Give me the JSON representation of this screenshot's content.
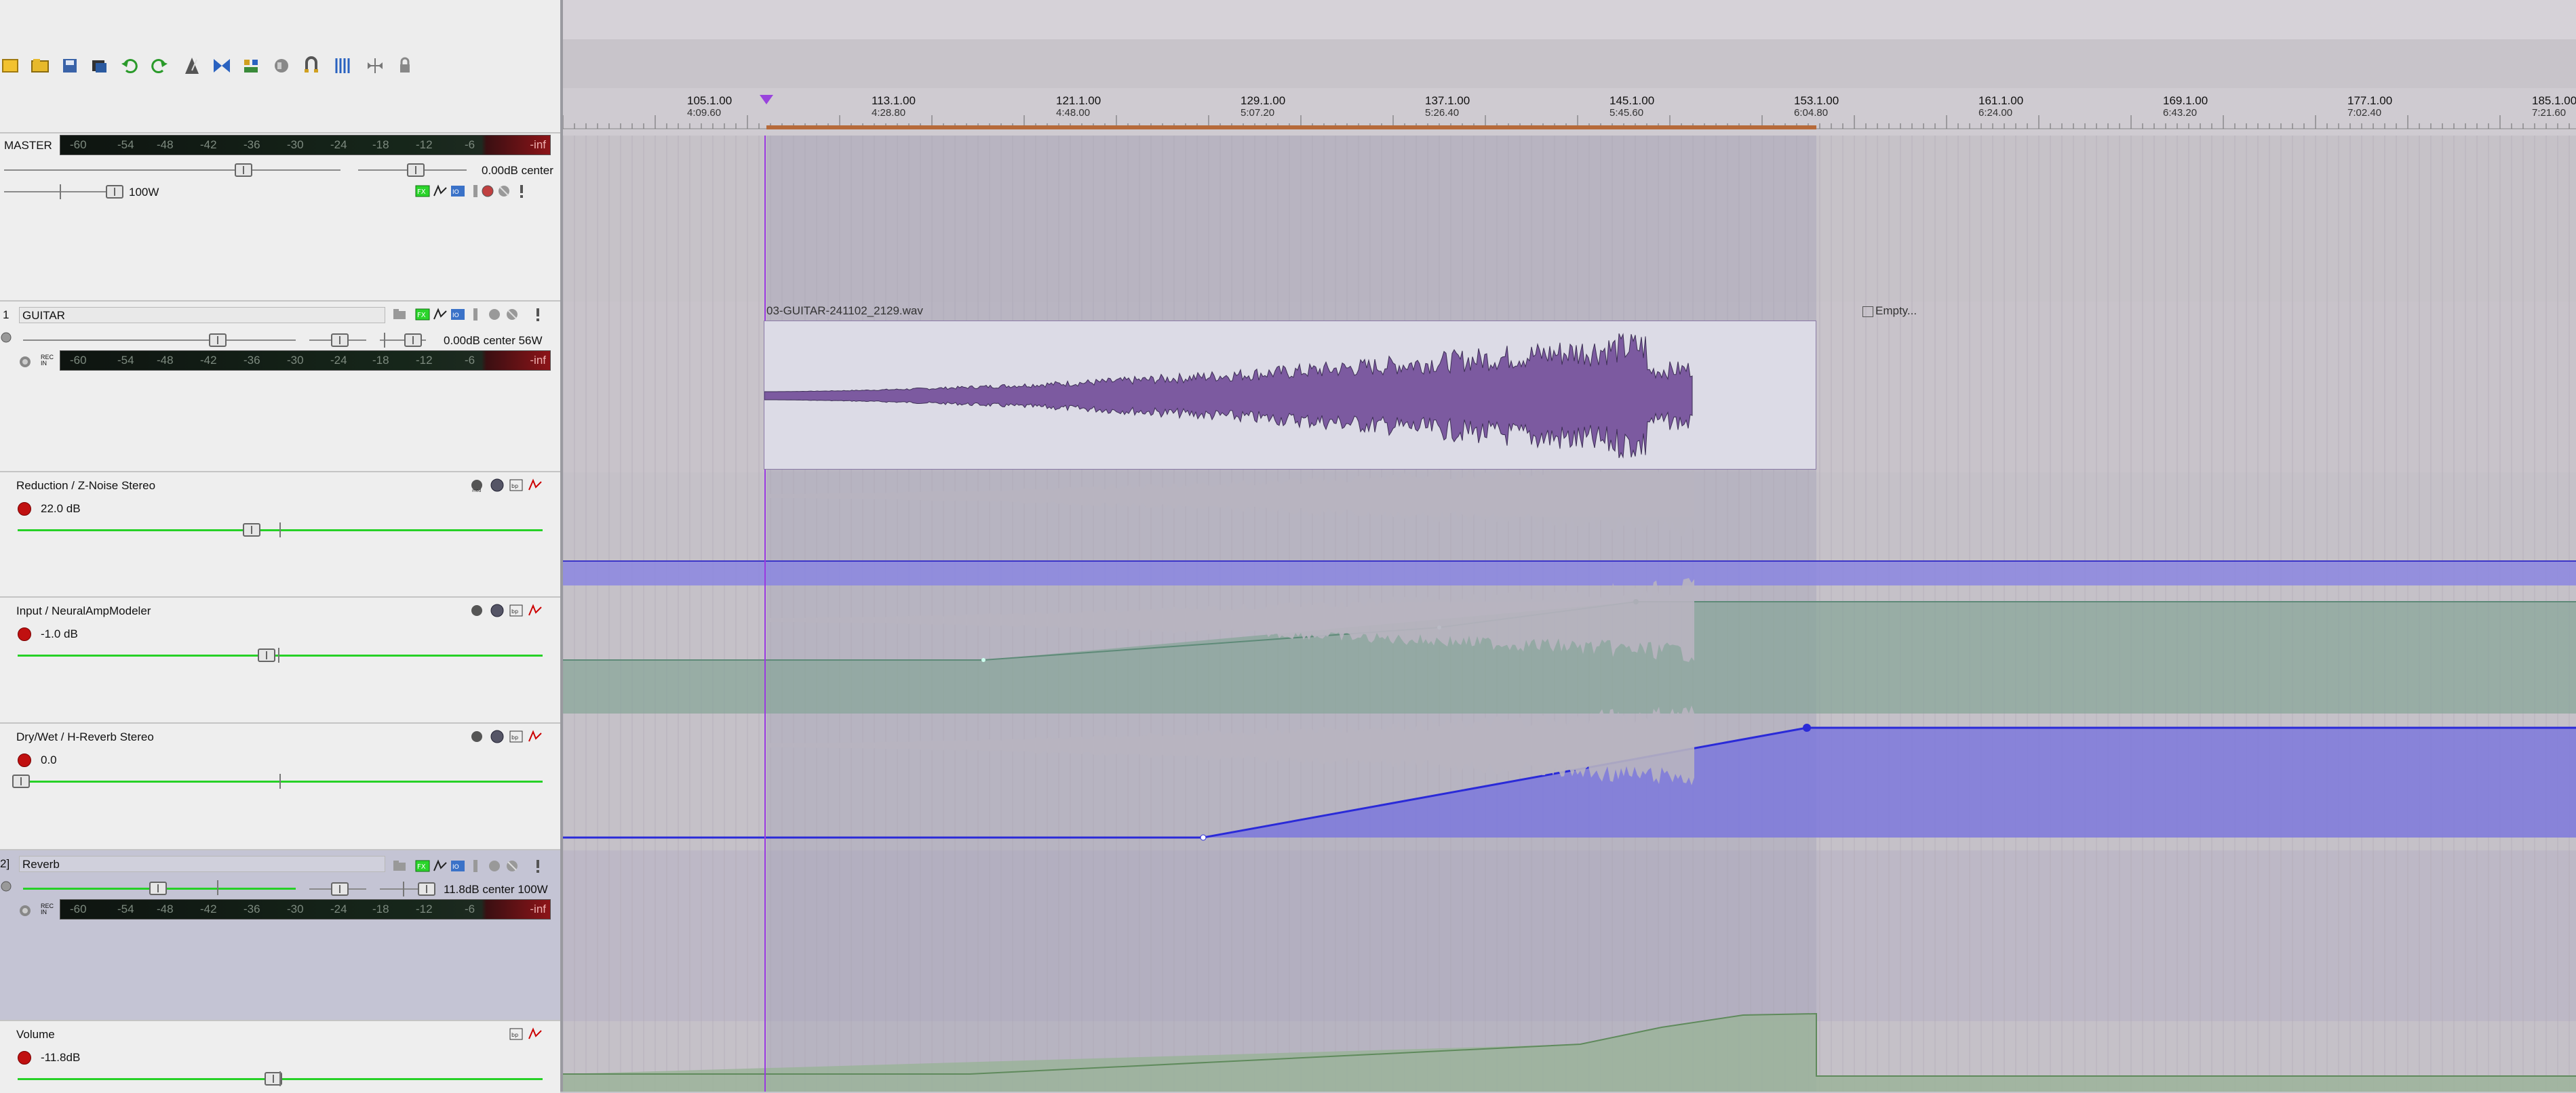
{
  "toolbar": {
    "icons": [
      "new-project-icon",
      "open-icon",
      "save-icon",
      "project-settings-icon",
      "undo-icon",
      "redo-icon",
      "metronome-icon",
      "loop-icon",
      "ripple-icon",
      "envelope-lock-icon",
      "snap-icon",
      "grid-icon",
      "crossfade-icon",
      "lock-icon"
    ]
  },
  "master": {
    "name": "MASTER",
    "vol_readout": "0.00dB center",
    "width_readout": "100W",
    "meter_inf": "-inf"
  },
  "meter_ticks": [
    "-60",
    "-54",
    "-48",
    "-42",
    "-36",
    "-30",
    "-24",
    "-18",
    "-12",
    "-6"
  ],
  "tracks": [
    {
      "number": "1",
      "name": "GUITAR",
      "readout": "0.00dB center 56W",
      "meter_inf": "-inf",
      "rec_label": "REC\nIN"
    },
    {
      "number": "2]",
      "name": "Reverb",
      "readout": "11.8dB center 100W",
      "meter_inf": "-inf",
      "rec_label": "REC\nIN"
    }
  ],
  "envelopes": [
    {
      "name": "Reduction / Z-Noise Stereo",
      "value": "22.0 dB"
    },
    {
      "name": "Input / NeuralAmpModeler",
      "value": "-1.0 dB"
    },
    {
      "name": "Dry/Wet / H-Reverb Stereo",
      "value": "0.0"
    },
    {
      "name": "Volume",
      "value": "-11.8dB"
    }
  ],
  "ruler": [
    {
      "bar": "105.1.00",
      "time": "4:09.60"
    },
    {
      "bar": "113.1.00",
      "time": "4:28.80"
    },
    {
      "bar": "121.1.00",
      "time": "4:48.00"
    },
    {
      "bar": "129.1.00",
      "time": "5:07.20"
    },
    {
      "bar": "137.1.00",
      "time": "5:26.40"
    },
    {
      "bar": "145.1.00",
      "time": "5:45.60"
    },
    {
      "bar": "153.1.00",
      "time": "6:04.80"
    },
    {
      "bar": "161.1.00",
      "time": "6:24.00"
    },
    {
      "bar": "169.1.00",
      "time": "6:43.20"
    },
    {
      "bar": "177.1.00",
      "time": "7:02.40"
    },
    {
      "bar": "185.1.00",
      "time": "7:21.60"
    }
  ],
  "items": {
    "guitar_item": "03-GUITAR-241102_2129.wav",
    "empty_item": "Empty..."
  },
  "colors": {
    "accent": "#8a56c8",
    "envelope_blue": "#2a2ad8",
    "envelope_green": "#26d126"
  }
}
